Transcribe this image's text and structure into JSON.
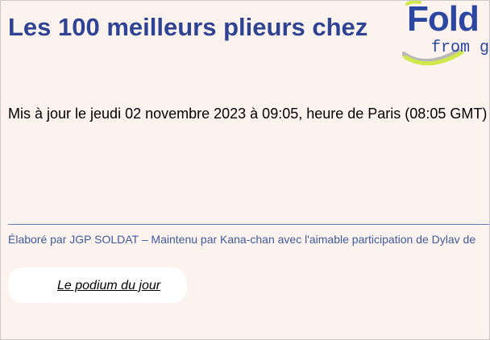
{
  "header": {
    "title": "Les 100 meilleurs plieurs chez"
  },
  "logo": {
    "word": "Fold",
    "sub": "from g",
    "colors": {
      "text": "#2b47a0",
      "ring": "#cfe84a",
      "ring_shadow": "#b8b8b8"
    }
  },
  "update": {
    "text": "Mis à jour le jeudi 02 novembre 2023 à 09:05, heure de Paris (08:05 GMT)"
  },
  "footer": {
    "credits": "Élaboré par JGP SOLDAT – Maintenu par Kana-chan avec l'aimable participation de Dylav de"
  },
  "podium": {
    "link_label": "Le podium du jour"
  },
  "colors": {
    "background": "#fdf3ee",
    "title": "#2e4394",
    "credits": "#3d5a9e",
    "divider": "#6479b5"
  }
}
